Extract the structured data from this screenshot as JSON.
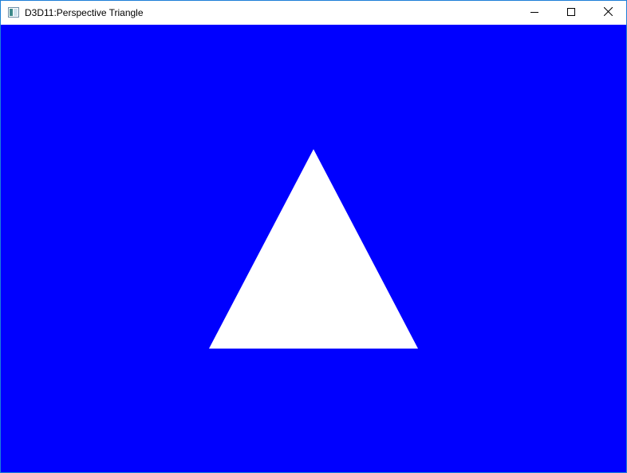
{
  "window": {
    "title": "D3D11:Perspective Triangle",
    "icon": "app-window-icon",
    "accent_border": "#1e7fd8"
  },
  "caption_buttons": [
    {
      "name": "minimize",
      "icon": "minimize-icon"
    },
    {
      "name": "maximize",
      "icon": "maximize-icon"
    },
    {
      "name": "close",
      "icon": "close-icon"
    }
  ],
  "scene": {
    "clear_color": "#0000ff",
    "triangle_color": "#ffffff"
  }
}
